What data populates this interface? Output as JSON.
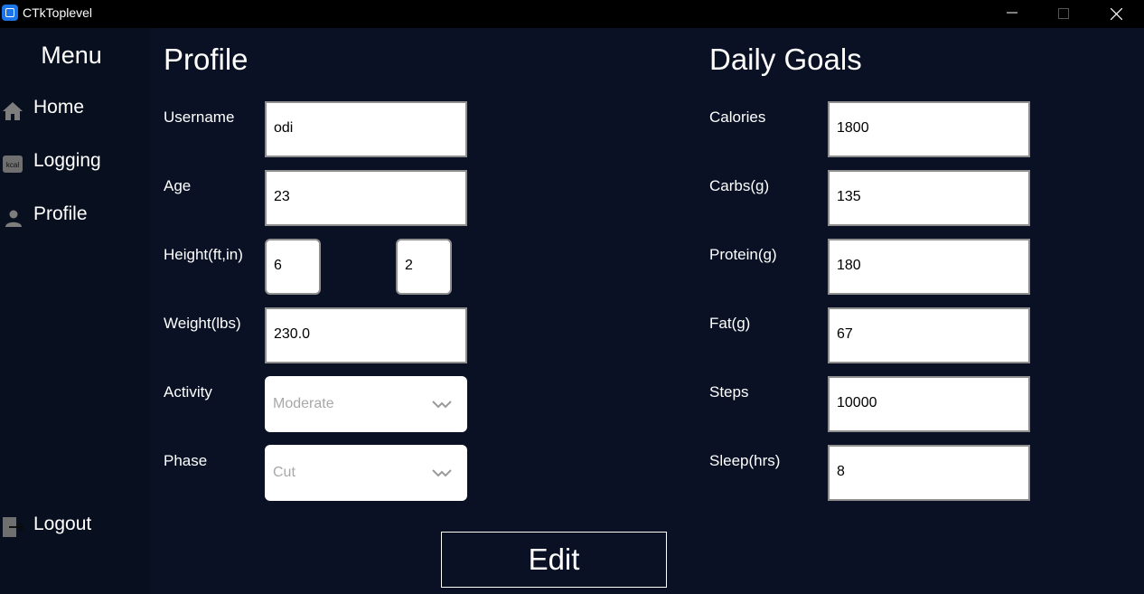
{
  "window": {
    "title": "CTkToplevel",
    "controls": [
      "minimize-icon",
      "maximize-icon",
      "close-icon"
    ]
  },
  "sidebar": {
    "title": "Menu",
    "items": [
      {
        "label": "Home",
        "icon": "home-icon"
      },
      {
        "label": "Logging",
        "icon": "kcal-icon",
        "icon_text": "kcal"
      },
      {
        "label": "Profile",
        "icon": "user-icon"
      }
    ],
    "logout": {
      "label": "Logout",
      "icon": "logout-icon"
    }
  },
  "profile": {
    "title": "Profile",
    "username": {
      "label": "Username",
      "value": "odi"
    },
    "age": {
      "label": "Age",
      "value": "23"
    },
    "height": {
      "label": "Height(ft,in)",
      "feet": "6",
      "inches": "2"
    },
    "weight": {
      "label": "Weight(lbs)",
      "value": "230.0"
    },
    "activity": {
      "label": "Activity",
      "value": "Moderate"
    },
    "phase": {
      "label": "Phase",
      "value": "Cut"
    }
  },
  "goals": {
    "title": "Daily Goals",
    "calories": {
      "label": "Calories",
      "value": "1800"
    },
    "carbs": {
      "label": "Carbs(g)",
      "value": "135"
    },
    "protein": {
      "label": "Protein(g)",
      "value": "180"
    },
    "fat": {
      "label": "Fat(g)",
      "value": "67"
    },
    "steps": {
      "label": "Steps",
      "value": "10000"
    },
    "sleep": {
      "label": "Sleep(hrs)",
      "value": "8"
    }
  },
  "actions": {
    "edit_label": "Edit"
  },
  "colors": {
    "background": "#0a1124",
    "sidebar": "#08101f",
    "titlebar": "#000000",
    "accent": "#1b74e8",
    "field": "#ffffff",
    "field_border": "#8f8f8f"
  }
}
